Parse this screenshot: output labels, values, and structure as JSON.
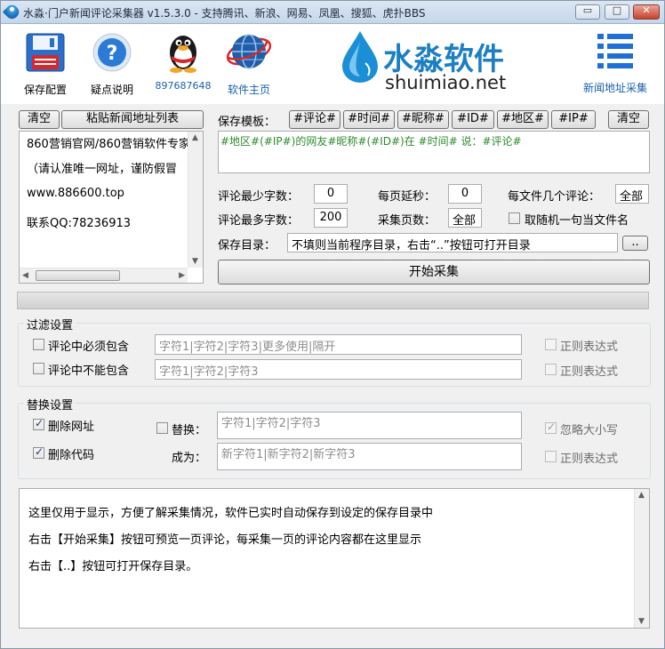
{
  "title_bar": {
    "title": "水淼·门户新闻评论采集器 v1.5.3.0 - 支持腾讯、新浪、网易、凤凰、搜狐、虎扑BBS",
    "minimize_glyph": "▭",
    "maximize_glyph": "□",
    "close_glyph": "✕"
  },
  "toolbar": {
    "save_config": "保存配置",
    "help": "疑点说明",
    "qq_number": "897687648",
    "home_page": "软件主页",
    "news_url_collect": "新闻地址采集",
    "logo_cn": "水淼软件",
    "logo_en": "shuimiao.net",
    "icons": [
      "floppy-disk-icon",
      "help-icon",
      "qq-penguin-icon",
      "globe-icon",
      "list-icon"
    ]
  },
  "url_panel": {
    "clear_button": "清空",
    "paste_button": "粘贴新闻地址列表",
    "lines": [
      "860营销官网/860营销软件专家",
      "（请认准唯一网址，谨防假冒",
      " www.886600.top",
      "联系QQ:78236913"
    ]
  },
  "template": {
    "label": "保存模板：",
    "tags": [
      "#评论#",
      "#时间#",
      "#昵称#",
      "#ID#",
      "#地区#",
      "#IP#"
    ],
    "clear_button": "清空",
    "text": "#地区#(#IP#)的网友#昵称#(#ID#)在 #时间# 说：#评论#"
  },
  "settings": {
    "min_chars_label": "评论最少字数：",
    "min_chars_value": "0",
    "max_chars_label": "评论最多字数：",
    "max_chars_value": "200",
    "page_delay_label": "每页延秒：",
    "page_delay_value": "0",
    "pages_label": "采集页数：",
    "pages_value": "全部",
    "per_file_label": "每文件几个评论：",
    "per_file_value": "全部",
    "random_filename_label": "取随机一句当文件名",
    "random_filename_checked": false,
    "save_dir_label": "保存目录：",
    "save_dir_value": "不填则当前程序目录，右击“..”按钮可打开目录",
    "browse_button": "..",
    "start_button": "开始采集"
  },
  "filter": {
    "title": "过滤设置",
    "must_contain_label": "评论中必须包含",
    "must_contain_checked": false,
    "must_contain_placeholder": "字符1|字符2|字符3|更多使用|隔开",
    "must_not_contain_label": "评论中不能包含",
    "must_not_contain_checked": false,
    "must_not_contain_placeholder": "字符1|字符2|字符3",
    "regex_label_1": "正则表达式",
    "regex_label_2": "正则表达式"
  },
  "replace": {
    "title": "替换设置",
    "remove_url_label": "删除网址",
    "remove_url_checked": true,
    "remove_code_label": "删除代码",
    "remove_code_checked": true,
    "replace_label": "替换：",
    "replace_checked": false,
    "replace_placeholder": "字符1|字符2|字符3",
    "into_label": "成为：",
    "into_placeholder": "新字符1|新字符2|新字符3",
    "ignore_case_label": "忽略大小写",
    "ignore_case_checked": true,
    "regex_label": "正则表达式"
  },
  "log": {
    "lines": [
      "这里仅用于显示，方便了解采集情况，软件已实时自动保存到设定的保存目录中",
      "右击【开始采集】按钮可预览一页评论，每采集一页的评论内容都在这里显示",
      "右击【..】按钮可打开保存目录。"
    ]
  },
  "colors": {
    "accent": "#1b7fc4",
    "template_text": "#2f8a2f",
    "qq_number": "#1b5fae",
    "window_bg": "#f0f0f0"
  }
}
